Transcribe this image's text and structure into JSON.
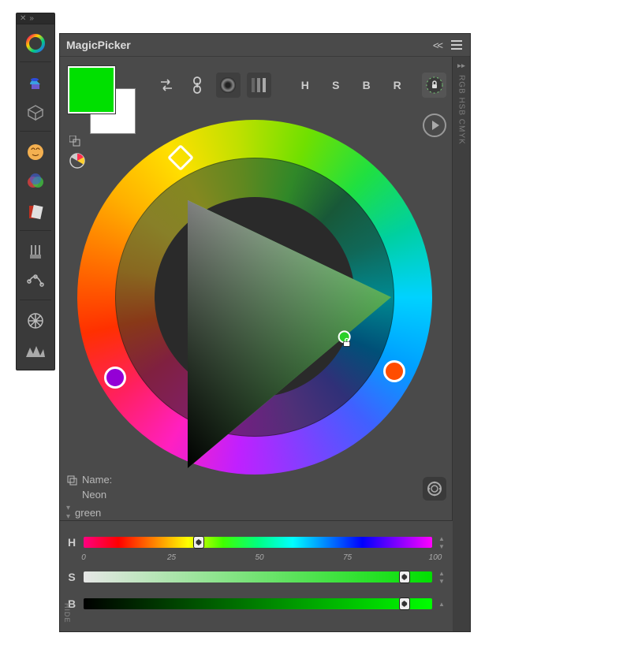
{
  "sidebar": {
    "icons": [
      {
        "name": "picker-ring-icon"
      },
      {
        "name": "paint-bucket-icon"
      },
      {
        "name": "cube-icon"
      },
      {
        "name": "palette-face-icon"
      },
      {
        "name": "mixer-icon"
      },
      {
        "name": "swatch-book-icon"
      },
      {
        "name": "brushes-icon"
      },
      {
        "name": "curves-icon"
      },
      {
        "name": "wheel-spoke-icon"
      },
      {
        "name": "mountains-icon"
      }
    ]
  },
  "panel": {
    "title": "MagicPicker"
  },
  "right_strip": {
    "label": "RGB HSB CMYK"
  },
  "swatch": {
    "foreground": "#00E000",
    "background": "#FFFFFF"
  },
  "toolbar": {
    "items": [
      {
        "kind": "icon",
        "name": "swap-arrows-icon",
        "label": ""
      },
      {
        "kind": "icon",
        "name": "link-icon",
        "label": ""
      },
      {
        "kind": "icon",
        "name": "tone-ring-icon",
        "label": ""
      },
      {
        "kind": "icon",
        "name": "vertical-bars-icon",
        "label": ""
      },
      {
        "kind": "text",
        "name": "hue-mode-button",
        "label": "H"
      },
      {
        "kind": "text",
        "name": "saturation-mode-button",
        "label": "S"
      },
      {
        "kind": "text",
        "name": "brightness-mode-button",
        "label": "B"
      },
      {
        "kind": "text",
        "name": "red-mode-button",
        "label": "R"
      },
      {
        "kind": "icon",
        "name": "color-lock-button",
        "label": ""
      }
    ]
  },
  "wheel": {
    "hue_marker_angle_deg": 118,
    "comp_markers": [
      {
        "name": "complement-marker-a",
        "color": "#ff4d00",
        "angle_deg": -28
      },
      {
        "name": "complement-marker-b",
        "color": "#9400d6",
        "angle_deg": 210
      }
    ],
    "triangle_color": "#22c21f",
    "pick_marker": {
      "color": "#28d028",
      "x_pct": 77,
      "y_pct": 51
    }
  },
  "name_block": {
    "label": "Name:",
    "value1": "Neon",
    "value2": "green"
  },
  "sliders": {
    "hue": {
      "label": "H",
      "value_pct": 33
    },
    "saturation": {
      "label": "S",
      "value_pct": 92
    },
    "brightness": {
      "label": "B",
      "value_pct": 92
    },
    "ticks": [
      {
        "label": "0",
        "pct": 0
      },
      {
        "label": "25",
        "pct": 25
      },
      {
        "label": "50",
        "pct": 50
      },
      {
        "label": "75",
        "pct": 75
      },
      {
        "label": "100",
        "pct": 100
      }
    ]
  },
  "hide_label": "HIDE"
}
